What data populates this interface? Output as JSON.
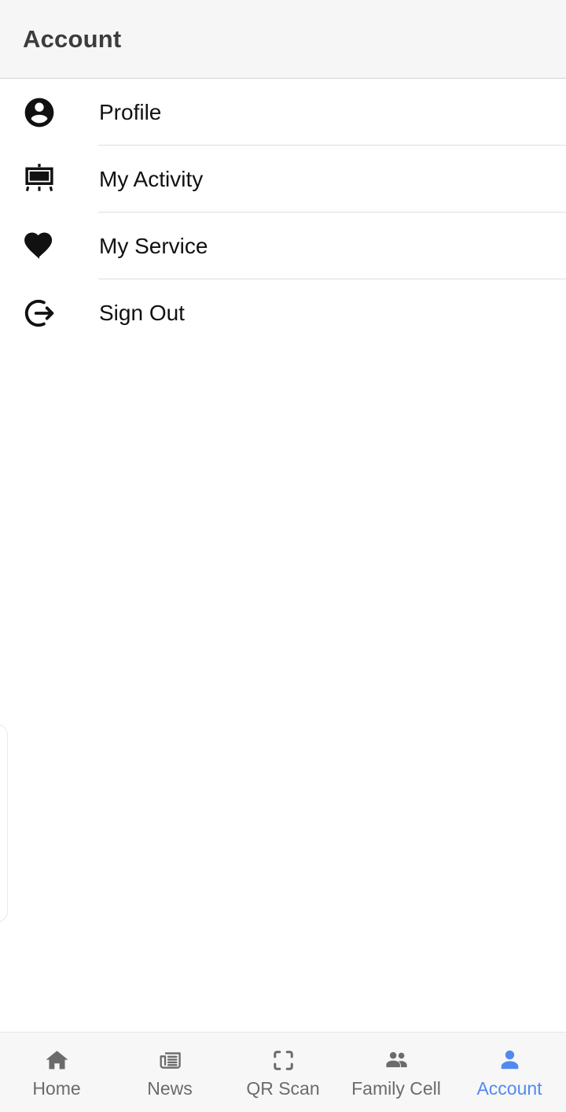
{
  "header": {
    "title": "Account"
  },
  "colors": {
    "accent": "#5289f0",
    "header_bg": "#f6f6f6",
    "nav_bg": "#f7f7f7",
    "text": "#111111",
    "muted_text": "#6b6b6b",
    "divider": "#dedede"
  },
  "menu": {
    "items": [
      {
        "label": "Profile",
        "icon": "account-circle-icon",
        "divider": true
      },
      {
        "label": "My Activity",
        "icon": "easel-icon",
        "divider": true
      },
      {
        "label": "My Service",
        "icon": "heart-icon",
        "divider": true
      },
      {
        "label": "Sign Out",
        "icon": "logout-icon",
        "divider": false
      }
    ]
  },
  "bottom_nav": {
    "active": "Account",
    "items": [
      {
        "label": "Home",
        "icon": "home-icon",
        "active": false
      },
      {
        "label": "News",
        "icon": "newspaper-icon",
        "active": false
      },
      {
        "label": "QR Scan",
        "icon": "qr-scan-icon",
        "active": false
      },
      {
        "label": "Family Cell",
        "icon": "people-icon",
        "active": false
      },
      {
        "label": "Account",
        "icon": "person-icon",
        "active": true
      }
    ]
  }
}
